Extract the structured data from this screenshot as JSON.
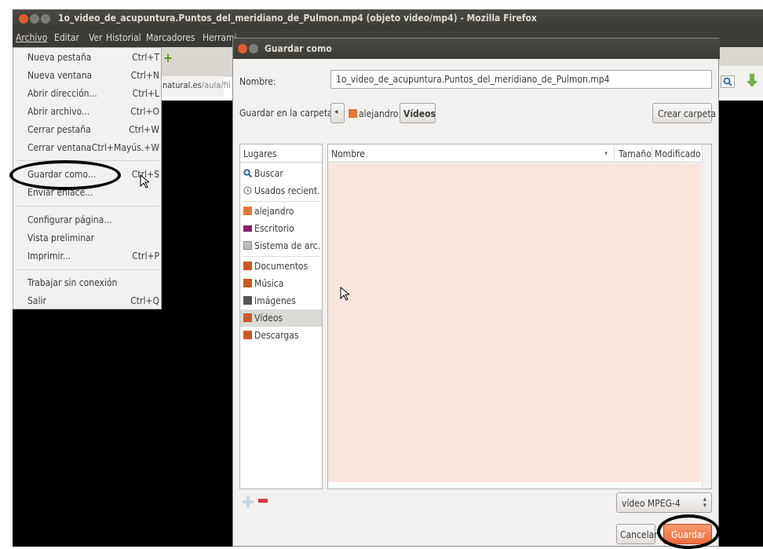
{
  "window": {
    "title": "1o_video_de_acupuntura.Puntos_del_meridiano_de_Pulmon.mp4 (objeto video/mp4) - Mozilla Firefox",
    "colors": {
      "close": "#e05c2f",
      "minimize": "#7d7c78",
      "maximize": "#7d7c78"
    }
  },
  "menubar": {
    "items": [
      "Archivo",
      "Editar",
      "Ver",
      "Historial",
      "Marcadores",
      "Herrami"
    ]
  },
  "toolbar": {
    "url_host": "natural.es",
    "url_path": "/aula/fil"
  },
  "file_menu": {
    "items": [
      {
        "label": "Nueva pestaña",
        "accel": "Ctrl+T"
      },
      {
        "label": "Nueva ventana",
        "accel": "Ctrl+N"
      },
      {
        "label": "Abrir dirección...",
        "accel": "Ctrl+L"
      },
      {
        "label": "Abrir archivo...",
        "accel": "Ctrl+O"
      },
      {
        "label": "Cerrar pestaña",
        "accel": "Ctrl+W"
      },
      {
        "label": "Cerrar ventana",
        "accel": "Ctrl+Mayús.+W"
      },
      {
        "label": "Guardar como...",
        "accel": "Ctrl+S"
      },
      {
        "label": "Enviar enlace...",
        "accel": ""
      },
      {
        "label": "Configurar página...",
        "accel": ""
      },
      {
        "label": "Vista preliminar",
        "accel": ""
      },
      {
        "label": "Imprimir...",
        "accel": "Ctrl+P"
      },
      {
        "label": "Trabajar sin conexión",
        "accel": ""
      },
      {
        "label": "Salir",
        "accel": "Ctrl+Q"
      }
    ]
  },
  "dialog": {
    "title": "Guardar como",
    "name_label": "Nombre:",
    "name_value": "1o_video_de_acupuntura.Puntos_del_meridiano_de_Pulmon.mp4",
    "folder_label": "Guardar en la carpeta:",
    "path_back": "◂",
    "path_parent": "alejandro",
    "path_current": "Vídeos",
    "new_folder": "Crear carpeta",
    "places_header": "Lugares",
    "places": [
      {
        "label": "Buscar",
        "icon": "search-icon",
        "color": "#3465a4"
      },
      {
        "label": "Usados recient...",
        "icon": "recent-icon",
        "color": "#888888"
      },
      {
        "label": "alejandro",
        "icon": "home-folder-icon",
        "color": "#e07b39"
      },
      {
        "label": "Escritorio",
        "icon": "desktop-icon",
        "color": "#8a1f6a"
      },
      {
        "label": "Sistema de arc...",
        "icon": "drive-icon",
        "color": "#999999"
      },
      {
        "label": "Documentos",
        "icon": "documents-folder-icon",
        "color": "#c85a25"
      },
      {
        "label": "Música",
        "icon": "music-folder-icon",
        "color": "#c85a25"
      },
      {
        "label": "Imágenes",
        "icon": "pictures-folder-icon",
        "color": "#555555"
      },
      {
        "label": "Vídeos",
        "icon": "videos-folder-icon",
        "color": "#c85a25"
      },
      {
        "label": "Descargas",
        "icon": "downloads-folder-icon",
        "color": "#c85a25"
      }
    ],
    "columns": {
      "name": "Nombre",
      "sort": "▾",
      "size": "Tamaño",
      "modified": "Modificado"
    },
    "filter_value": "vídeo MPEG-4",
    "cancel": "Cancelar",
    "save": "Guardar"
  }
}
